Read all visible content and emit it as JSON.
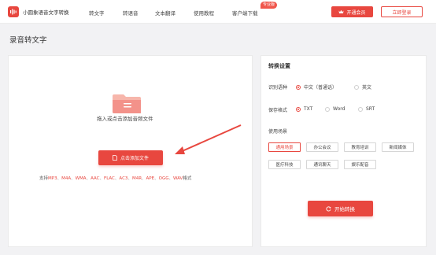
{
  "app": {
    "name": "小圆象语音文字转换"
  },
  "nav": {
    "items": [
      "转文字",
      "转语音",
      "文本翻译",
      "使用教程",
      "客户端下载"
    ],
    "pro_badge": "专业版"
  },
  "header": {
    "vip_label": "开通会员",
    "login_label": "立即登录"
  },
  "page": {
    "title": "录音转文字"
  },
  "upload": {
    "hint": "拖入或点击添加音频文件",
    "button_label": "点击添加文件",
    "formats_prefix": "支持",
    "formats": [
      "MP3",
      "M4A",
      "WMA",
      "AAC",
      "FLAC",
      "AC3",
      "M4R",
      "APE",
      "OGG",
      "WAV"
    ],
    "formats_suffix": "格式"
  },
  "settings": {
    "title": "转换设置",
    "language": {
      "label": "识别语种",
      "options": [
        "中文（普通话）",
        "英文"
      ],
      "selected": 0
    },
    "format": {
      "label": "保存格式",
      "options": [
        "TXT",
        "Word",
        "SRT"
      ],
      "selected": 0
    },
    "scene": {
      "label": "使用场景",
      "options": [
        "通用场景",
        "办公会议",
        "教育培训",
        "新闻媒体",
        "医疗科技",
        "通讯聊天",
        "娱乐配音"
      ],
      "selected": 0
    },
    "convert_label": "开始转换"
  },
  "colors": {
    "accent": "#e8473f",
    "folder": "#f4a294"
  },
  "icons": [
    "app-logo-icon",
    "crown-icon",
    "folder-icon",
    "file-icon",
    "refresh-icon",
    "arrow-annotation"
  ]
}
